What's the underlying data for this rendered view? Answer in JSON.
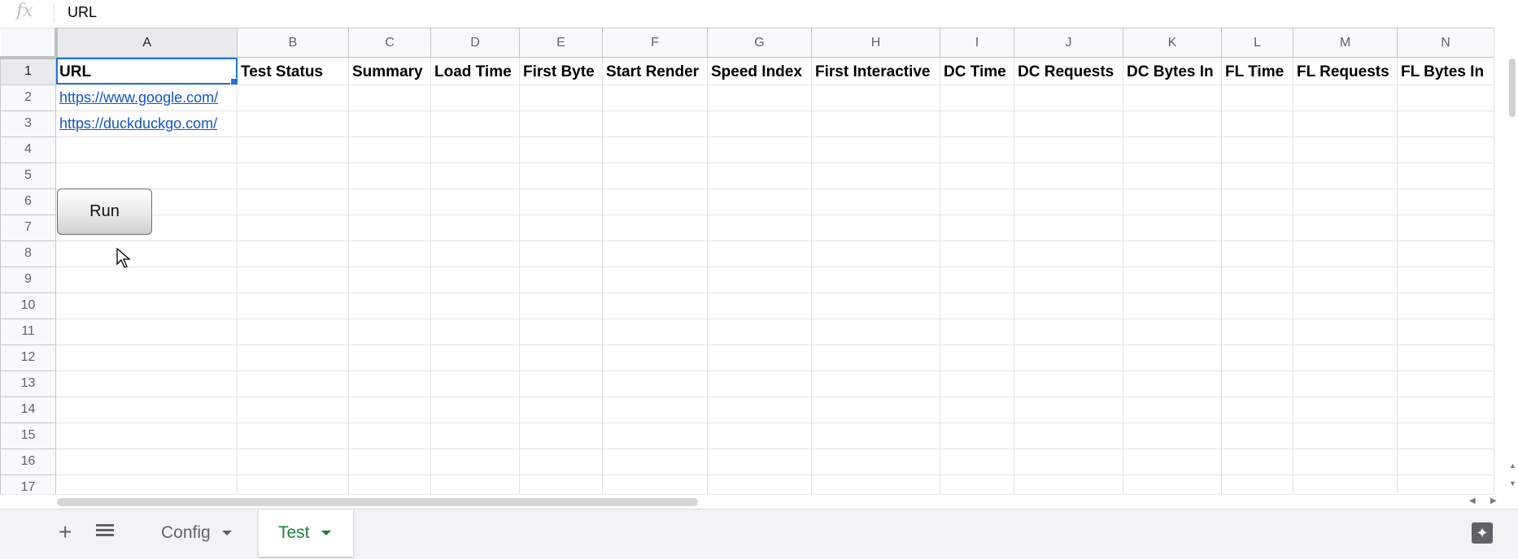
{
  "formula_bar": {
    "fx_label": "fx",
    "value": "URL"
  },
  "columns": [
    "A",
    "B",
    "C",
    "D",
    "E",
    "F",
    "G",
    "H",
    "I",
    "J",
    "K",
    "L",
    "M",
    "N"
  ],
  "rows": [
    "1",
    "2",
    "3",
    "4",
    "5",
    "6",
    "7",
    "8",
    "9",
    "10",
    "11",
    "12",
    "13",
    "14",
    "15",
    "16",
    "17"
  ],
  "header_row": [
    "URL",
    "Test Status",
    "Summary",
    "Load Time",
    "First Byte",
    "Start Render",
    "Speed Index",
    "First Interactive",
    "DC Time",
    "DC Requests",
    "DC Bytes In",
    "FL Time",
    "FL Requests",
    "FL Bytes In"
  ],
  "data": {
    "a2": "https://www.google.com/",
    "a3": "https://duckduckgo.com/"
  },
  "run_button": {
    "label": "Run"
  },
  "sheet_tabs": [
    {
      "label": "Config",
      "active": false
    },
    {
      "label": "Test",
      "active": true
    }
  ],
  "colors": {
    "link": "#1155cc",
    "selection": "#1a73e8",
    "active_tab_text": "#188038"
  }
}
